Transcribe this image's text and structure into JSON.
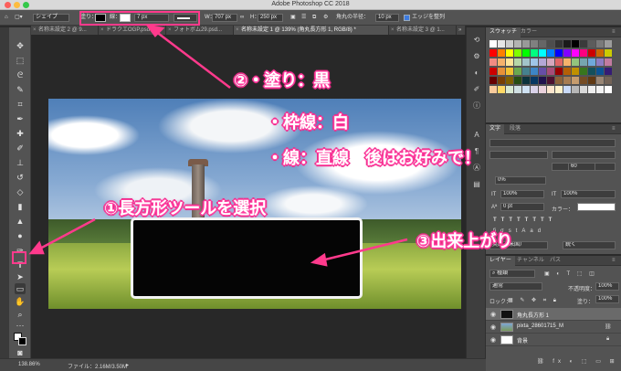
{
  "window": {
    "title": "Adobe Photoshop CC 2018"
  },
  "options_bar": {
    "mode": "シェイプ",
    "fill_label": "塗り：",
    "stroke_label": "線：",
    "stroke_width": "7 px",
    "w_label": "W：",
    "w_value": "707 px",
    "h_label": "H：",
    "h_value": "250 px",
    "radius_label": "角丸の半径：",
    "radius_value": "10 px",
    "align_edges_label": "エッジを整列"
  },
  "tabs": [
    {
      "label": "名称未設定 2 @ 9..."
    },
    {
      "label": "ドラクエOGP.psd"
    },
    {
      "label": "フォトボム29.psd..."
    },
    {
      "label": "名称未設定 1 @ 139% (角丸長方形 1, RGB/8) *"
    },
    {
      "label": "名称未設定 3 @ 1..."
    }
  ],
  "swatches_panel": {
    "tabs": [
      "スウォッチ",
      "カラー"
    ]
  },
  "character_panel": {
    "tabs": [
      "文字",
      "段落"
    ],
    "leading_value": "0%",
    "size_value": "0 pt",
    "tracking_value": "100%",
    "scale_value": "100%",
    "auto_value": "60",
    "color_label": "カラー：",
    "aa_lang": "英語（米国）",
    "aa_mode": "鋭く"
  },
  "layers_panel": {
    "tabs": [
      "レイヤー",
      "チャンネル",
      "パス"
    ],
    "search_placeholder": "種類",
    "blend_mode": "通常",
    "opacity_label": "不透明度：",
    "opacity_value": "100%",
    "lock_label": "ロック：",
    "fill_label": "塗り：",
    "fill_value": "100%",
    "layers": [
      {
        "name": "角丸長方形 1",
        "thumb_color": "#111111"
      },
      {
        "name": "pixta_28601715_M",
        "thumb_color": "#7a9a5a"
      },
      {
        "name": "背景",
        "thumb_color": "#ffffff"
      }
    ]
  },
  "status_bar": {
    "zoom": "138.86%",
    "file_info": "ファイル：2.16M/3.50M"
  },
  "annotations": {
    "note2_line1": "②・塗り：黒",
    "note2_line2": "・枠線：白",
    "note2_line3": "・線：直線　後はお好みで！",
    "note1": "①長方形ツールを選択",
    "note3": "③出来上がり",
    "accent_color": "#ff3a8c"
  }
}
